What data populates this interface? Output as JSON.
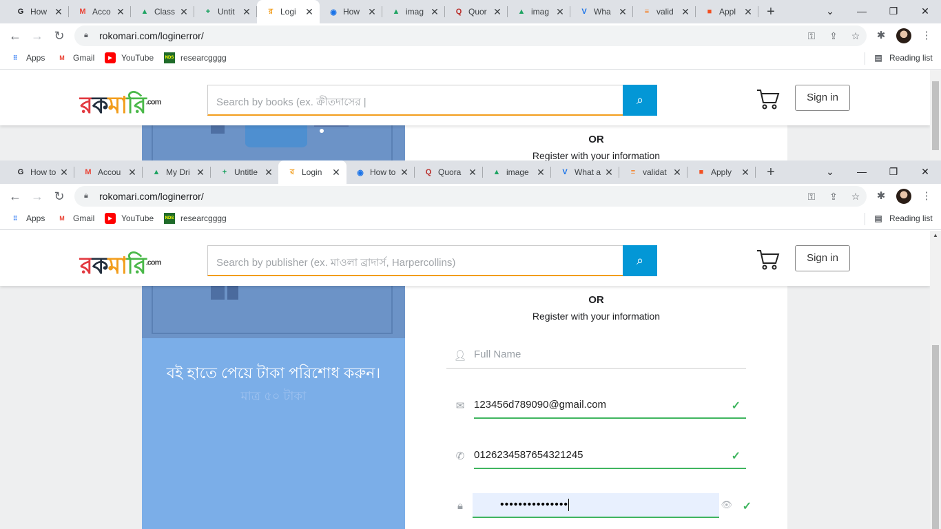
{
  "shot1": {
    "tabs": [
      {
        "title": "How",
        "icon": "G",
        "color": "#202124"
      },
      {
        "title": "Acco",
        "icon": "M",
        "color": "#ea4335"
      },
      {
        "title": "Class",
        "icon": "▲",
        "color": "#1fa463"
      },
      {
        "title": "Untit",
        "icon": "+",
        "color": "#0f9d58"
      },
      {
        "title": "Logi",
        "icon": "র",
        "color": "#f29d1b"
      },
      {
        "title": "How",
        "icon": "◉",
        "color": "#1a73e8"
      },
      {
        "title": "imag",
        "icon": "▲",
        "color": "#1fa463"
      },
      {
        "title": "Quor",
        "icon": "Q",
        "color": "#b92b27"
      },
      {
        "title": "imag",
        "icon": "▲",
        "color": "#1fa463"
      },
      {
        "title": "Wha",
        "icon": "V",
        "color": "#1a73e8"
      },
      {
        "title": "valid",
        "icon": "≡",
        "color": "#f48024"
      },
      {
        "title": "Appl",
        "icon": "■",
        "color": "#f25022"
      }
    ],
    "search_placeholder": "Search by books (ex. ক্রীতদাসের |"
  },
  "shot2": {
    "tabs": [
      {
        "title": "How to",
        "icon": "G",
        "color": "#202124"
      },
      {
        "title": "Accou",
        "icon": "M",
        "color": "#ea4335"
      },
      {
        "title": "My Dri",
        "icon": "▲",
        "color": "#1fa463"
      },
      {
        "title": "Untitle",
        "icon": "+",
        "color": "#0f9d58"
      },
      {
        "title": "Login",
        "icon": "র",
        "color": "#f29d1b"
      },
      {
        "title": "How to",
        "icon": "◉",
        "color": "#1a73e8"
      },
      {
        "title": "Quora",
        "icon": "Q",
        "color": "#b92b27"
      },
      {
        "title": "image",
        "icon": "▲",
        "color": "#1fa463"
      },
      {
        "title": "What a",
        "icon": "V",
        "color": "#1a73e8"
      },
      {
        "title": "validat",
        "icon": "≡",
        "color": "#f48024"
      },
      {
        "title": "Apply",
        "icon": "■",
        "color": "#f25022"
      }
    ],
    "search_placeholder": "Search by publisher (ex. মাওলা ব্রাদার্স, Harpercollins)"
  },
  "browser": {
    "url": "rokomari.com/loginerror/",
    "bookmarks": [
      {
        "label": "Apps",
        "icon": "apps-grid-icon"
      },
      {
        "label": "Gmail",
        "icon": "gmail-icon"
      },
      {
        "label": "YouTube",
        "icon": "youtube-icon"
      },
      {
        "label": "researcgggg",
        "icon": "nds-icon"
      }
    ],
    "reading_list": "Reading list",
    "new_tab": "+"
  },
  "site": {
    "logo": {
      "l1": "র",
      "l2": "ক",
      "l3": "মা",
      "l4": "রি",
      "com": ".com"
    },
    "sign_in": "Sign in",
    "or": "OR",
    "register_text": "Register with your information",
    "banner_line1": "বই হাতে পেয়ে টাকা পরিশোধ করুন।",
    "banner_line2": "মাত্র ৫০ টাকা"
  },
  "form": {
    "full_name_placeholder": "Full Name",
    "email_value": "123456d789090@gmail.com",
    "phone_value": "0126234587654321245",
    "password_dots": "•••••••••••••••"
  }
}
